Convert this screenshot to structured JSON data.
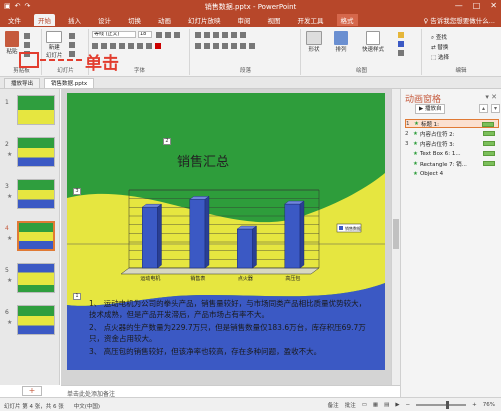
{
  "titlebar": {
    "title": "销售数据.pptx - PowerPoint",
    "qa_icons": [
      "save-icon",
      "undo-icon",
      "redo-icon"
    ],
    "window_controls": [
      "—",
      "□",
      "✕"
    ]
  },
  "tabs": [
    {
      "label": "文件"
    },
    {
      "label": "开始",
      "active": true
    },
    {
      "label": "插入"
    },
    {
      "label": "设计"
    },
    {
      "label": "切换"
    },
    {
      "label": "动画"
    },
    {
      "label": "幻灯片放映"
    },
    {
      "label": "审阅"
    },
    {
      "label": "视图"
    },
    {
      "label": "开发工具"
    },
    {
      "label": "格式",
      "contextual": true
    }
  ],
  "tell_me": "♀ 告诉我您想要做什么...",
  "ribbon": {
    "clipboard_label": "剪贴板",
    "paste_label": "粘贴",
    "slides_label": "幻灯片",
    "new_slide_label": "新建\n幻灯片",
    "font_label": "字体",
    "font_name": "等线 (正文)",
    "font_size": "18",
    "paragraph_label": "段落",
    "drawing_label": "绘图",
    "shapes_label": "形状",
    "arrange_label": "排列",
    "quick_styles_label": "快速样式",
    "editing_label": "编辑",
    "find_label": "查找",
    "replace_label": "替换",
    "select_label": "选择"
  },
  "annotation": {
    "text": "单击",
    "color": "#e23d2e"
  },
  "file_tabs": [
    {
      "label": "播放导出"
    },
    {
      "label": "销售数据.pptx",
      "active": true
    }
  ],
  "thumbnails": [
    {
      "num": "1"
    },
    {
      "num": "2"
    },
    {
      "num": "3"
    },
    {
      "num": "4",
      "selected": true
    },
    {
      "num": "5"
    },
    {
      "num": "6"
    }
  ],
  "slide": {
    "title": "销售汇总",
    "label_2": "2",
    "label_3": "3",
    "label_1": "1",
    "bullets": [
      "1、 运动电机为公司的拳头产品，销售量较好，与市场同类产品相比质量优势较大，技术成熟，但是产品开发滞后，产品市场占有率不大。",
      "2、 点火器的生产数量为229.7万只，但是销售数量仅183.6万台，库存积压69.7万只，资金占用较大。",
      "3、 高压包的销售较好，但该净率也较高，存在多种问题，盈收不大。"
    ]
  },
  "chart_data": {
    "type": "bar",
    "categories": [
      "运动电机",
      "销售表",
      "点火器",
      "高压包"
    ],
    "values": [
      78,
      88,
      50,
      82
    ],
    "ylim": [
      0,
      100
    ],
    "legend": "销售数据",
    "color": "#3b59c4"
  },
  "notes": "单击此处添加备注",
  "animation_pane": {
    "title": "动画窗格",
    "play_label": "▶ 播放自",
    "items": [
      {
        "num": "1",
        "label": "标题 1:",
        "bar": true,
        "selected": true
      },
      {
        "num": "2",
        "label": "内容占位符 2:",
        "bar": true
      },
      {
        "num": "3",
        "label": "内容占位符 3:",
        "bar": true
      },
      {
        "num": "",
        "label": "Text Box 6: 1...",
        "bar": true
      },
      {
        "num": "",
        "label": "Rectangle 7: 销...",
        "bar": true
      },
      {
        "num": "",
        "label": "Object 4",
        "bar": false
      }
    ]
  },
  "status": {
    "slide_info": "幻灯片 第 4 张，共 6 张",
    "lang": "中文(中国)",
    "notes_btn": "备注",
    "comments_btn": "批注",
    "zoom": "76%"
  }
}
